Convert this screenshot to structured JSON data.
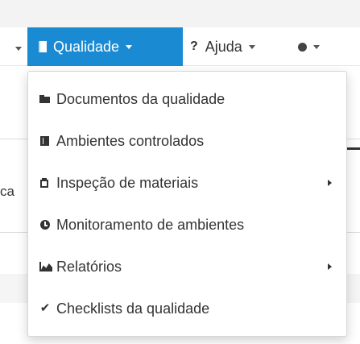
{
  "navbar": {
    "active_label": "Qualidade",
    "help_label": "Ajuda",
    "help_icon": "?",
    "accent_color": "#1a8bd3",
    "settings_icon": "gear-icon"
  },
  "background": {
    "partial_text": "ca"
  },
  "menu": {
    "items": [
      {
        "label": "Documentos da qualidade",
        "icon": "folder-icon",
        "has_submenu": false
      },
      {
        "label": "Ambientes controlados",
        "icon": "book-icon",
        "has_submenu": false
      },
      {
        "label": "Inspeção de materiais",
        "icon": "clipboard-icon",
        "has_submenu": true
      },
      {
        "label": "Monitoramento de ambientes",
        "icon": "clock-icon",
        "has_submenu": false
      },
      {
        "label": "Relatórios",
        "icon": "area-chart-icon",
        "has_submenu": true
      },
      {
        "label": "Checklists da qualidade",
        "icon": "check-icon",
        "has_submenu": false
      }
    ]
  }
}
